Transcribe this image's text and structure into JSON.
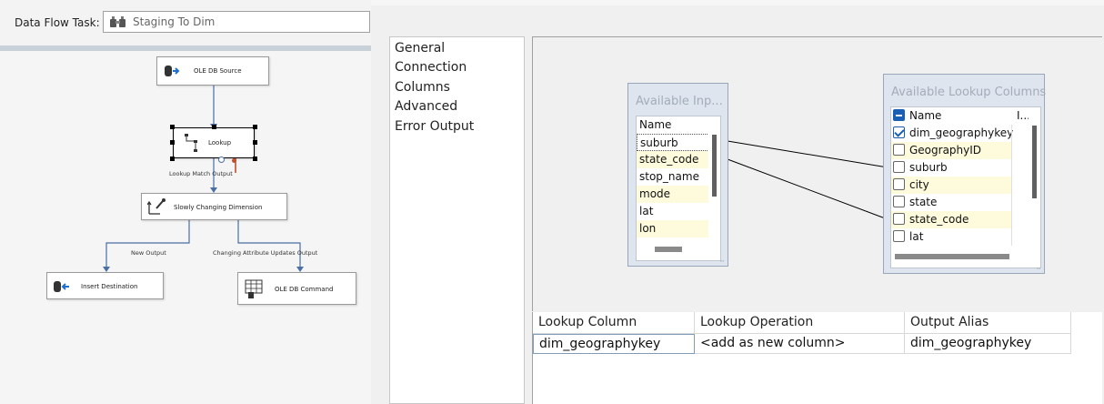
{
  "designer": {
    "task_label": "Data Flow Task:",
    "task_value": "Staging To Dim",
    "components": {
      "ole_db_source": "OLE DB Source",
      "lookup": "Lookup",
      "scd": "Slowly Changing Dimension",
      "insert_destination": "Insert Destination",
      "ole_db_command": "OLE DB Command"
    },
    "paths": {
      "lookup_match_output": "Lookup Match Output",
      "new_output": "New Output",
      "changing_attribute_output": "Changing Attribute Updates Output"
    }
  },
  "editor": {
    "pages": [
      "General",
      "Connection",
      "Columns",
      "Advanced",
      "Error Output"
    ],
    "available_input": {
      "title": "Available Inp...",
      "header": "Name",
      "rows": [
        "suburb",
        "state_code",
        "stop_name",
        "mode",
        "lat",
        "lon"
      ]
    },
    "available_lookup": {
      "title": "Available Lookup Columns",
      "header": "Name",
      "header2": "I...",
      "rows": [
        {
          "name": "dim_geographykey",
          "checked": true
        },
        {
          "name": "GeographyID",
          "checked": false
        },
        {
          "name": "suburb",
          "checked": false
        },
        {
          "name": "city",
          "checked": false
        },
        {
          "name": "state",
          "checked": false
        },
        {
          "name": "state_code",
          "checked": false
        },
        {
          "name": "lat",
          "checked": false
        }
      ]
    },
    "grid": {
      "headers": [
        "Lookup Column",
        "Lookup Operation",
        "Output Alias"
      ],
      "rows": [
        [
          "dim_geographykey",
          "<add as new column>",
          "dim_geographykey"
        ]
      ]
    }
  },
  "colors": {
    "table_bg": "#dfe5ee",
    "row_highlight": "#fefbdc",
    "checkbox_blue": "#1a5fb4",
    "connector": "#4a6fa5",
    "error_path": "#c0502a"
  },
  "icons": {
    "task": "data-flow-task-icon",
    "source": "ole-db-source-icon",
    "lookup": "lookup-icon",
    "scd": "slowly-changing-dimension-icon",
    "destination": "insert-destination-icon",
    "command": "ole-db-command-icon"
  }
}
